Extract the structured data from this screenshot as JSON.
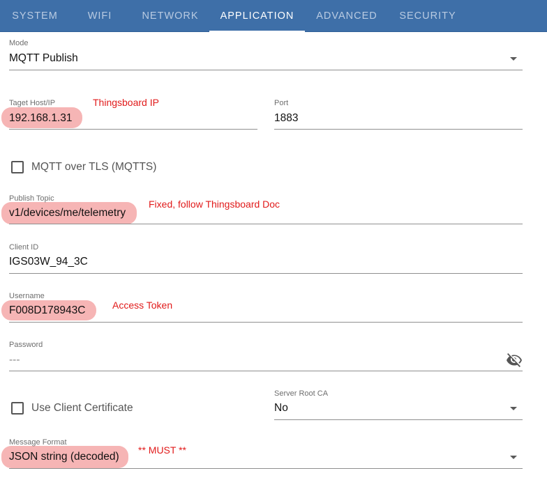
{
  "tabs": [
    {
      "label": "SYSTEM"
    },
    {
      "label": "WIFI"
    },
    {
      "label": "NETWORK"
    },
    {
      "label": "APPLICATION"
    },
    {
      "label": "ADVANCED"
    },
    {
      "label": "SECURITY"
    }
  ],
  "active_tab": "APPLICATION",
  "mode": {
    "label": "Mode",
    "value": "MQTT Publish"
  },
  "target_host": {
    "label": "Taget Host/IP",
    "value": "192.168.1.31"
  },
  "port": {
    "label": "Port",
    "value": "1883"
  },
  "mqtt_tls": {
    "label": "MQTT over TLS (MQTTS)",
    "checked": false
  },
  "publish_topic": {
    "label": "Publish Topic",
    "value": "v1/devices/me/telemetry"
  },
  "client_id": {
    "label": "Client ID",
    "value": "IGS03W_94_3C"
  },
  "username": {
    "label": "Username",
    "value": "F008D178943C"
  },
  "password": {
    "label": "Password",
    "value": "---"
  },
  "client_cert": {
    "label": "Use Client Certificate",
    "checked": false
  },
  "server_root_ca": {
    "label": "Server Root CA",
    "value": "No"
  },
  "message_format": {
    "label": "Message Format",
    "value": "JSON string (decoded)"
  },
  "annotations": {
    "host": "Thingsboard IP",
    "topic": "Fixed, follow Thingsboard Doc",
    "username": "Access Token",
    "format": "** MUST **"
  },
  "colors": {
    "tabbar_bg": "#3e6fa8",
    "tab_active": "#ffffff",
    "tab_inactive": "#b9cbe2",
    "annotation_red": "#e11a1a",
    "highlight": "#ee7878"
  },
  "icons": {
    "dropdown": "chevron-down-icon",
    "password_toggle": "eye-off-icon"
  }
}
